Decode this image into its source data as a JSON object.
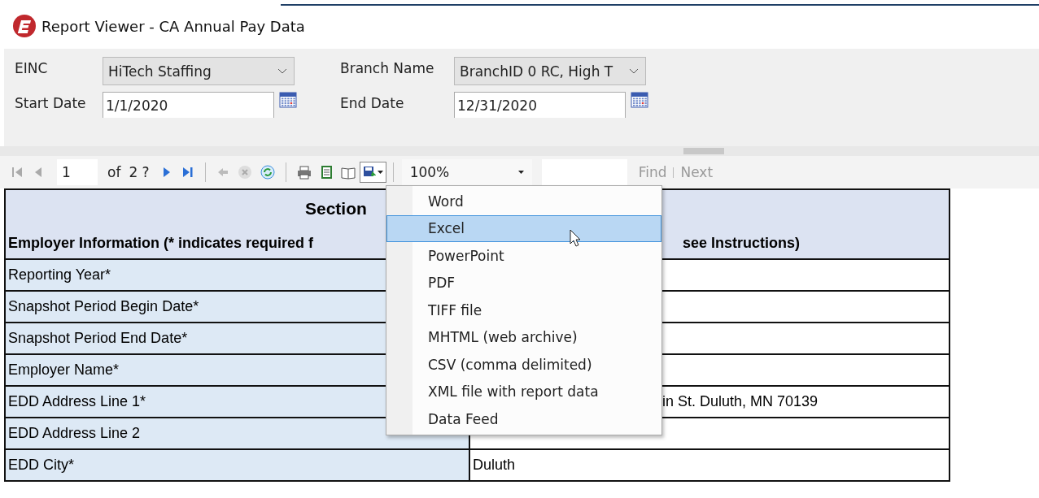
{
  "window": {
    "title": "Report Viewer - CA Annual Pay Data"
  },
  "parameters": [
    {
      "label": "EINC",
      "kind": "dropdown",
      "value": "HiTech Staffing"
    },
    {
      "label": "Branch Name",
      "kind": "dropdown",
      "value": "BranchID 0 RC, High T"
    },
    {
      "label": "Start Date",
      "kind": "date",
      "value": "1/1/2020"
    },
    {
      "label": "End Date",
      "kind": "date",
      "value": "12/31/2020"
    }
  ],
  "toolbar": {
    "page": "1",
    "of_label": "of",
    "page_count": "2 ?",
    "zoom": "100%",
    "find": {
      "label": "Find",
      "disabled": true
    },
    "next": {
      "label": "Next",
      "disabled": true
    }
  },
  "export_menu": {
    "open": true,
    "items": [
      {
        "label": "Word",
        "selected": false
      },
      {
        "label": "Excel",
        "selected": true
      },
      {
        "label": "PowerPoint",
        "selected": false
      },
      {
        "label": "PDF",
        "selected": false
      },
      {
        "label": "TIFF file",
        "selected": false
      },
      {
        "label": "MHTML (web archive)",
        "selected": false
      },
      {
        "label": "CSV (comma delimited)",
        "selected": false
      },
      {
        "label": "XML file with report data",
        "selected": false
      },
      {
        "label": "Data Feed",
        "selected": false
      }
    ]
  },
  "report": {
    "section_title": "Section",
    "header_left": "Employer Information (* indicates required f",
    "header_right": "see Instructions)",
    "rows": [
      {
        "label": "Reporting Year*"
      },
      {
        "label": "Snapshot Period Begin Date*"
      },
      {
        "label": "Snapshot Period End Date*"
      },
      {
        "label": "Employer Name*"
      },
      {
        "label": "EDD Address Line 1*",
        "value": "in St. Duluth, MN 70139"
      },
      {
        "label": "EDD Address Line 2"
      },
      {
        "label": "EDD City*",
        "value": "Duluth"
      }
    ]
  }
}
